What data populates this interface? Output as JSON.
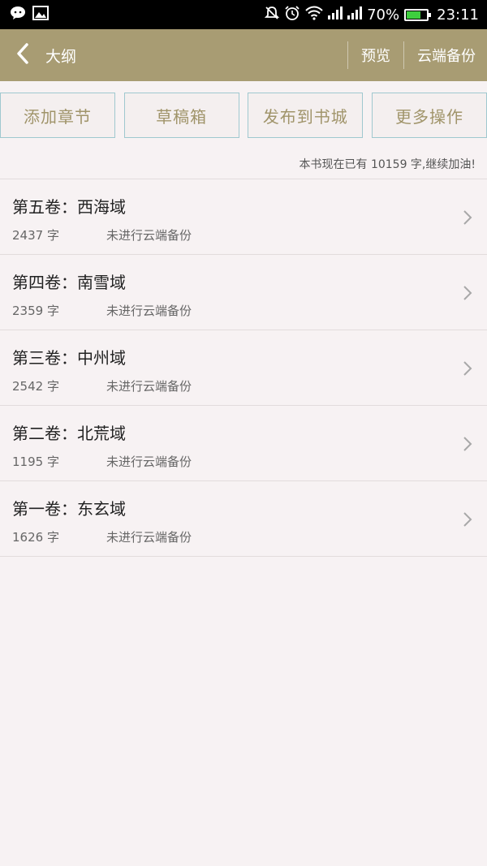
{
  "status_bar": {
    "battery_percent": "70%",
    "time": "23:11",
    "battery_level": 0.7,
    "battery_color": "#3ecf3e"
  },
  "header": {
    "title": "大纲",
    "preview_label": "预览",
    "cloud_backup_label": "云端备份",
    "background_color": "#a89c73"
  },
  "actions": {
    "add_chapter": "添加章节",
    "drafts": "草稿箱",
    "publish": "发布到书城",
    "more": "更多操作"
  },
  "summary": "本书现在已有 10159 字,继续加油!",
  "volumes": [
    {
      "title": "第五卷：西海域",
      "count": "2437 字",
      "status": "未进行云端备份"
    },
    {
      "title": "第四卷：南雪域",
      "count": "2359 字",
      "status": "未进行云端备份"
    },
    {
      "title": "第三卷：中州域",
      "count": "2542 字",
      "status": "未进行云端备份"
    },
    {
      "title": "第二卷：北荒域",
      "count": "1195 字",
      "status": "未进行云端备份"
    },
    {
      "title": "第一卷：东玄域",
      "count": "1626 字",
      "status": "未进行云端备份"
    }
  ],
  "icons": {
    "status_left": [
      "chat-bubble-icon",
      "image-icon"
    ],
    "status_right": [
      "mute-icon",
      "alarm-icon",
      "wifi-icon",
      "signal-icon",
      "signal-icon",
      "battery-icon"
    ],
    "back": "chevron-left-icon",
    "row_arrow": "chevron-right-icon"
  }
}
